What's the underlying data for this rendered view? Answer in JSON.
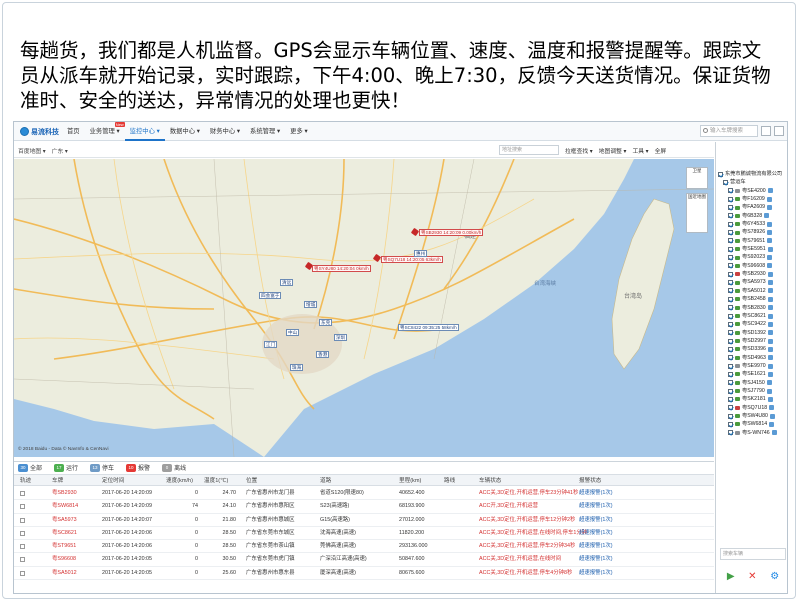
{
  "slide": {
    "heading": "每趟货，我们都是人机监督。GPS会显示车辆位置、速度、温度和报警提醒等。跟踪文员从派车就开始记录，实时跟踪，下午4:00、晚上7:30，反馈今天送货情况。保证货物准时、安全的送达，异常情况的处理也更快！"
  },
  "app": {
    "logo": "易流科技",
    "nav": [
      {
        "label": "首页"
      },
      {
        "label": "业务管理 ▾",
        "badge": "New"
      },
      {
        "label": "监控中心 ▾"
      },
      {
        "label": "数据中心 ▾"
      },
      {
        "label": "财务中心 ▾"
      },
      {
        "label": "系统管理 ▾"
      },
      {
        "label": "更多 ▾"
      }
    ],
    "search_placeholder": "输入车牌搜索",
    "toolbar": {
      "left": [
        "百度地图 ▾",
        "广东 ▾"
      ],
      "input_placeholder": "地址搜索",
      "right": [
        "拉框查找 ▾",
        "地图调整 ▾",
        "工具 ▾",
        "全屏"
      ]
    },
    "map": {
      "ctrl_satellite": "卫星",
      "ctrl_panorama": "国近地图",
      "copyright": "© 2018 Baidu - Data © NavInfo & CenNavi",
      "place_labels": [
        "福建",
        "台湾岛",
        "台湾海峡"
      ],
      "markers": [
        {
          "text": "粤SB2930 14:20:09 0.00km/h",
          "color": "red"
        },
        {
          "text": "粤SQ7U18 14:20:05 63km/h",
          "color": "red"
        },
        {
          "text": "粤SY4U80 14:20:04 0km/h",
          "color": "red"
        },
        {
          "text": "惠州",
          "color": "blue"
        },
        {
          "text": "清远",
          "color": "blue"
        },
        {
          "text": "四会富于",
          "color": "blue"
        },
        {
          "text": "增城",
          "color": "blue"
        },
        {
          "text": "粤SC8422 09:35:25 58km/h",
          "color": "blue"
        },
        {
          "text": "东莞",
          "color": "blue"
        },
        {
          "text": "深圳",
          "color": "blue"
        },
        {
          "text": "香港",
          "color": "blue"
        },
        {
          "text": "珠海",
          "color": "blue"
        },
        {
          "text": "江门",
          "color": "blue"
        },
        {
          "text": "中山",
          "color": "blue"
        }
      ]
    },
    "filters": [
      {
        "label": "全部",
        "count": "30",
        "color": "#4a8fd1"
      },
      {
        "label": "运行",
        "count": "17",
        "color": "#4caf50"
      },
      {
        "label": "停车",
        "count": "13",
        "color": "#6f9bc6"
      },
      {
        "label": "报警",
        "count": "10",
        "color": "#e53935"
      },
      {
        "label": "离线",
        "count": "0",
        "color": "#9e9e9e"
      }
    ],
    "table": {
      "columns": [
        "轨迹",
        "车牌",
        "定位时间",
        "速度(km/h)",
        "温度1(℃)",
        "位置",
        "道路",
        "里程(km)",
        "路线",
        "车辆状态",
        "报警状态"
      ],
      "rows": [
        [
          "",
          "粤SB2930",
          "2017-06-20 14:20:09",
          "0",
          "24.70",
          "广东省惠州市龙门县",
          "省道S120(限速80)",
          "40652.400",
          "",
          "ACC关,3D定位,开机运营,停车23分钟41秒",
          "超速报警(1次)"
        ],
        [
          "",
          "粤SW6814",
          "2017-06-20 14:20:09",
          "74",
          "24.10",
          "广东省惠州市惠阳区",
          "S23(高速路)",
          "68193.900",
          "",
          "ACC开,3D定位,开机运营",
          "超速报警(1次)"
        ],
        [
          "",
          "粤SA5973",
          "2017-06-20 14:20:07",
          "0",
          "21.80",
          "广东省惠州市惠城区",
          "G15(高速路)",
          "27012.000",
          "",
          "ACC关,3D定位,开机运营,停车12分钟2秒",
          "超速报警(1次)"
        ],
        [
          "",
          "粤SC8621",
          "2017-06-20 14:20:06",
          "0",
          "28.50",
          "广东省东莞市东城区",
          "沈海高速(高速)",
          "11820.200",
          "",
          "ACC关,3D定位,开机运营,在线时间,停车1分钟",
          "超速报警(1次)"
        ],
        [
          "",
          "粤ST9651",
          "2017-06-20 14:20:06",
          "0",
          "28.50",
          "广东省东莞市茶山镇",
          "莞佛高速(高速)",
          "293136.000",
          "",
          "ACC关,3D定位,开机运营,停车2分钟34秒",
          "超速报警(1次)"
        ],
        [
          "",
          "粤S96608",
          "2017-06-20 14:20:05",
          "0",
          "30.50",
          "广东省东莞市虎门镇",
          "广深沿江高速(高速)",
          "50847.600",
          "",
          "ACC关,3D定位,开机运营,在线时间",
          "超速报警(1次)"
        ],
        [
          "",
          "粤SA5012",
          "2017-06-20 14:20:05",
          "0",
          "25.60",
          "广东省惠州市惠东县",
          "厦深高速(高速)",
          "80675.600",
          "",
          "ACC关,3D定位,开机运营,停车4分钟8秒",
          "超速报警(1次)"
        ]
      ]
    },
    "sidepanel": {
      "company": "东莞市鹏诚物流有限公司",
      "group": "营运车",
      "vehicles": [
        {
          "plate": "粤SE4200",
          "state": "gray"
        },
        {
          "plate": "粤F16209",
          "state": "green"
        },
        {
          "plate": "粤FA2609",
          "state": "green"
        },
        {
          "plate": "粤6B328",
          "state": "green"
        },
        {
          "plate": "粤6Y4533",
          "state": "green"
        },
        {
          "plate": "粤S78926",
          "state": "green"
        },
        {
          "plate": "粤S79651",
          "state": "green"
        },
        {
          "plate": "粤SE5951",
          "state": "green"
        },
        {
          "plate": "粤S92023",
          "state": "green"
        },
        {
          "plate": "粤S96608",
          "state": "green"
        },
        {
          "plate": "粤SB2930",
          "state": "red"
        },
        {
          "plate": "粤SA5973",
          "state": "green"
        },
        {
          "plate": "粤SA5012",
          "state": "green"
        },
        {
          "plate": "粤SB2458",
          "state": "green"
        },
        {
          "plate": "粤SB2830",
          "state": "green"
        },
        {
          "plate": "粤SC8621",
          "state": "green"
        },
        {
          "plate": "粤SC9422",
          "state": "green"
        },
        {
          "plate": "粤SD1392",
          "state": "green"
        },
        {
          "plate": "粤SD2997",
          "state": "green"
        },
        {
          "plate": "粤SD3396",
          "state": "green"
        },
        {
          "plate": "粤SD4963",
          "state": "green"
        },
        {
          "plate": "粤SE9970",
          "state": "gray"
        },
        {
          "plate": "粤SE1621",
          "state": "green"
        },
        {
          "plate": "粤SJ4150",
          "state": "green"
        },
        {
          "plate": "粤SJ7790",
          "state": "green"
        },
        {
          "plate": "粤SK2181",
          "state": "green"
        },
        {
          "plate": "粤SQ7U18",
          "state": "red"
        },
        {
          "plate": "粤SW4U80",
          "state": "green"
        },
        {
          "plate": "粤SW6814",
          "state": "green"
        },
        {
          "plate": "粤S-WN746",
          "state": "gray"
        }
      ],
      "search_placeholder": "搜索车辆",
      "actions": [
        "▶",
        "✕",
        "⚙"
      ]
    }
  }
}
